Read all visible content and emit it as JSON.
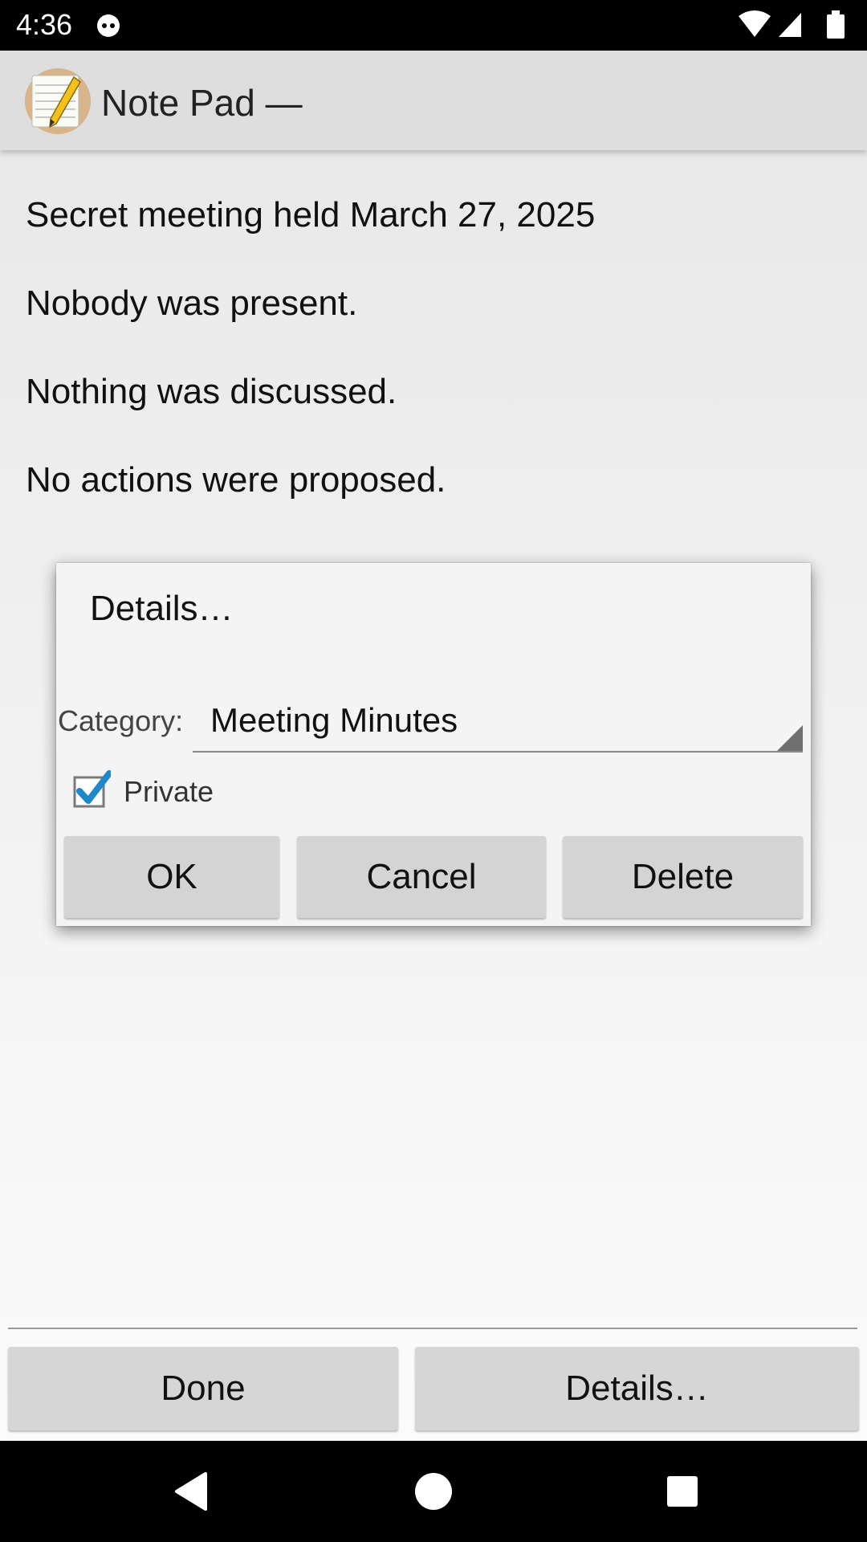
{
  "status_bar": {
    "time": "4:36",
    "icons": [
      "cat-notification-icon",
      "wifi-icon",
      "signal-icon",
      "battery-icon"
    ]
  },
  "app_bar": {
    "title": "Note Pad —",
    "icon": "notepad-app-icon"
  },
  "note": {
    "lines": [
      "Secret meeting held March 27, 2025",
      "Nobody was present.",
      "Nothing was discussed.",
      "No actions were proposed."
    ]
  },
  "dialog": {
    "title": "Details…",
    "category_label": "Category:",
    "category_value": "Meeting Minutes",
    "private_label": "Private",
    "private_checked": true,
    "ok_label": "OK",
    "cancel_label": "Cancel",
    "delete_label": "Delete"
  },
  "bottom_buttons": {
    "done_label": "Done",
    "details_label": "Details…"
  },
  "colors": {
    "checkbox_accent": "#1e88c8",
    "button_bg": "#d6d6d6",
    "app_bar_bg": "#dedede"
  }
}
